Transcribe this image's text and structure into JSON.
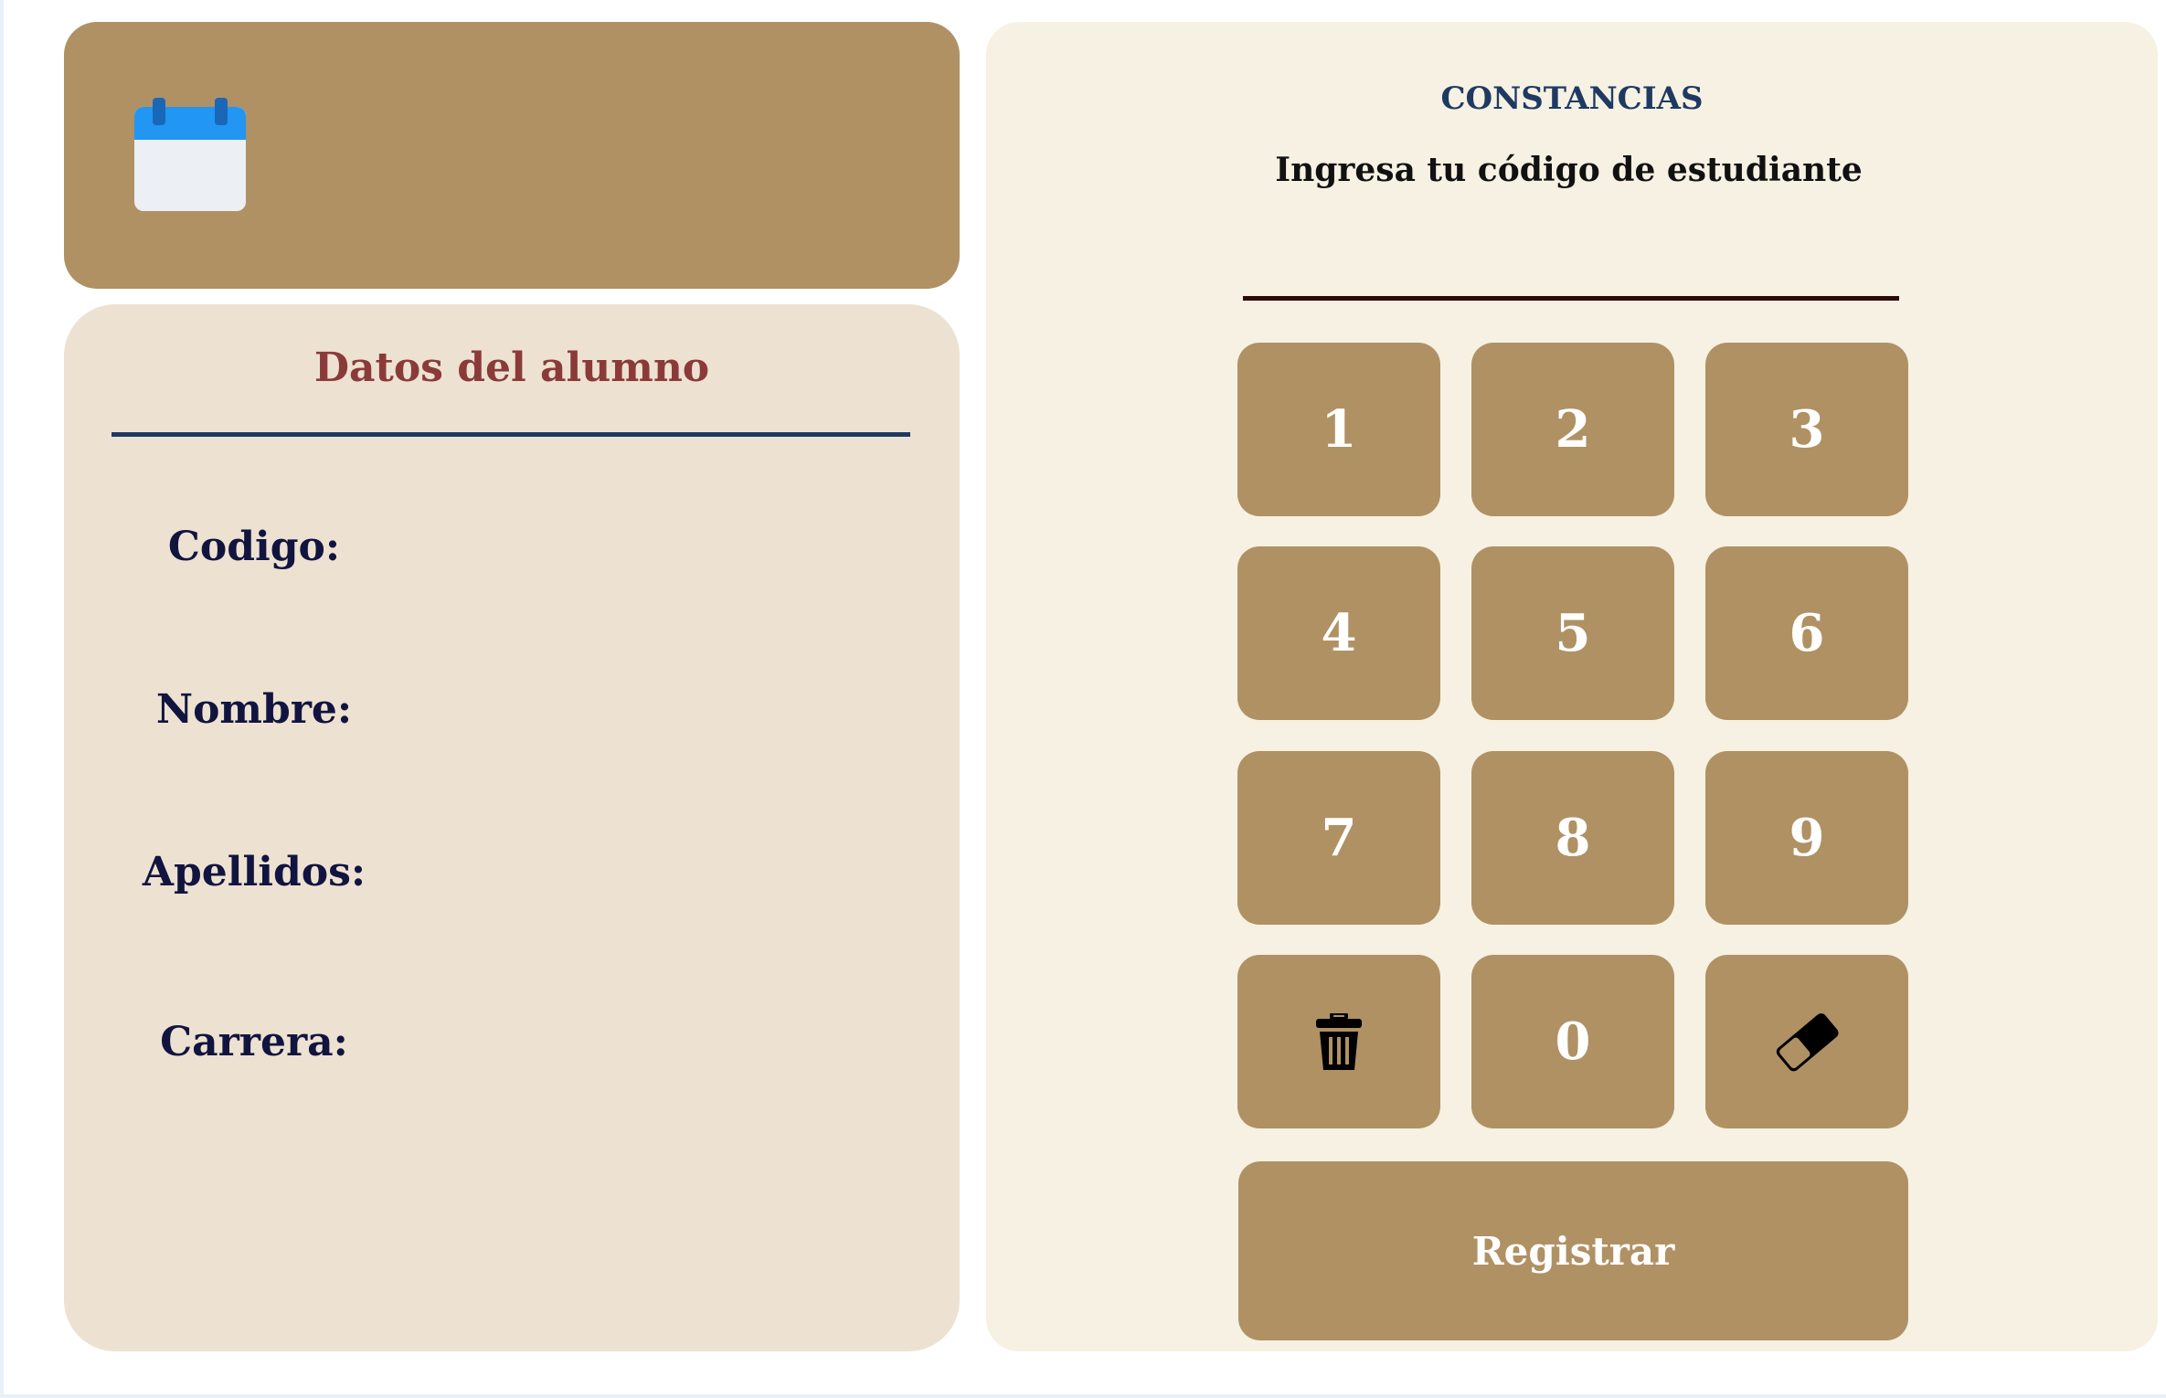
{
  "header": {
    "icon": "calendar-icon"
  },
  "student": {
    "title": "Datos del alumno",
    "fields": [
      {
        "label": "Codigo:",
        "value": ""
      },
      {
        "label": "Nombre:",
        "value": ""
      },
      {
        "label": "Apellidos:",
        "value": ""
      },
      {
        "label": "Carrera:",
        "value": ""
      }
    ]
  },
  "panel": {
    "title": "CONSTANCIAS",
    "subtitle": "Ingresa tu código de estudiante",
    "code_value": "",
    "keys": [
      {
        "label": "1"
      },
      {
        "label": "2"
      },
      {
        "label": "3"
      },
      {
        "label": "4"
      },
      {
        "label": "5"
      },
      {
        "label": "6"
      },
      {
        "label": "7"
      },
      {
        "label": "8"
      },
      {
        "label": "9"
      },
      {
        "icon": "trash-icon"
      },
      {
        "label": "0"
      },
      {
        "icon": "eraser-icon"
      }
    ],
    "register_label": "Registrar"
  },
  "colors": {
    "accent": "#b09164",
    "card_bg": "#ede2d1",
    "panel_bg": "#f6f1e2",
    "title_red": "#8b3a3a",
    "navy": "#1e3a63"
  }
}
